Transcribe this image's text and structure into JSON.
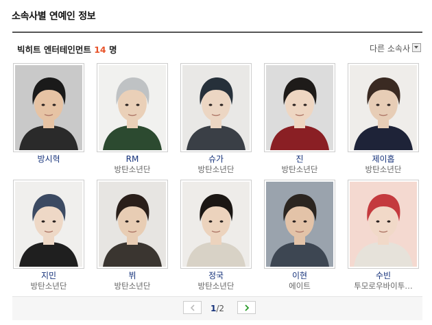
{
  "page": {
    "title": "소속사별 연예인 정보"
  },
  "agency": {
    "name": "빅히트 엔터테인먼트",
    "count": "14",
    "unit": "명"
  },
  "other_agency": {
    "label": "다른 소속사"
  },
  "celebs": [
    {
      "name": "방시혁",
      "group": "",
      "bg": "#c9c9c9",
      "hair": "#1a1a1a",
      "shirt": "#2a2a2a",
      "skin": "#e6c3a4"
    },
    {
      "name": "RM",
      "group": "방탄소년단",
      "bg": "#f1f1ef",
      "hair": "#bfc2c4",
      "shirt": "#2c4a30",
      "skin": "#ead0b8"
    },
    {
      "name": "슈가",
      "group": "방탄소년단",
      "bg": "#e9e8e6",
      "hair": "#26303a",
      "shirt": "#3a3f46",
      "skin": "#ecd6c3"
    },
    {
      "name": "진",
      "group": "방탄소년단",
      "bg": "#dcdcdc",
      "hair": "#1e1b19",
      "shirt": "#8a1f24",
      "skin": "#eed6c2"
    },
    {
      "name": "제이홉",
      "group": "방탄소년단",
      "bg": "#efedea",
      "hair": "#3a2a22",
      "shirt": "#1e2338",
      "skin": "#e7cdb6"
    },
    {
      "name": "지민",
      "group": "방탄소년단",
      "bg": "#f0efed",
      "hair": "#3c4a62",
      "shirt": "#1f1f1f",
      "skin": "#eed8c6"
    },
    {
      "name": "뷔",
      "group": "방탄소년단",
      "bg": "#e7e5e2",
      "hair": "#2a1f1a",
      "shirt": "#3a3530",
      "skin": "#e8cdb4"
    },
    {
      "name": "정국",
      "group": "방탄소년단",
      "bg": "#eeece9",
      "hair": "#1b1714",
      "shirt": "#d8d2c6",
      "skin": "#ecd3bd"
    },
    {
      "name": "이현",
      "group": "에이트",
      "bg": "#9aa3ad",
      "hair": "#2b2520",
      "shirt": "#3d4652",
      "skin": "#e3c3a8"
    },
    {
      "name": "수빈",
      "group": "투모로우바이투…",
      "bg": "#f4d9d0",
      "hair": "#c43a3e",
      "shirt": "#e6e2da",
      "skin": "#f1d9c8"
    }
  ],
  "pager": {
    "current": "1",
    "separator": "/",
    "total": "2"
  }
}
